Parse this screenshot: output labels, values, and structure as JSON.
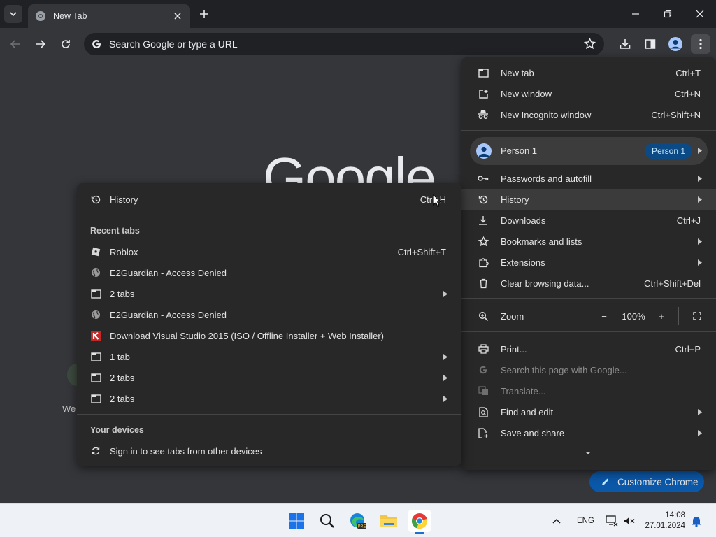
{
  "browser": {
    "tab_title": "New Tab",
    "omnibox_placeholder": "Search Google or type a URL"
  },
  "page": {
    "logo_text": "Google",
    "welcome_partial": "We",
    "customize_label": "Customize Chrome"
  },
  "main_menu": {
    "items": [
      {
        "label": "New tab",
        "shortcut": "Ctrl+T"
      },
      {
        "label": "New window",
        "shortcut": "Ctrl+N"
      },
      {
        "label": "New Incognito window",
        "shortcut": "Ctrl+Shift+N"
      }
    ],
    "profile": {
      "name": "Person 1",
      "badge": "Person 1"
    },
    "items2": [
      {
        "label": "Passwords and autofill"
      },
      {
        "label": "History"
      },
      {
        "label": "Downloads",
        "shortcut": "Ctrl+J"
      },
      {
        "label": "Bookmarks and lists"
      },
      {
        "label": "Extensions"
      },
      {
        "label": "Clear browsing data...",
        "shortcut": "Ctrl+Shift+Del"
      }
    ],
    "zoom": {
      "label": "Zoom",
      "minus": "−",
      "value": "100%",
      "plus": "+"
    },
    "items3": [
      {
        "label": "Print...",
        "shortcut": "Ctrl+P"
      },
      {
        "label": "Search this page with Google..."
      },
      {
        "label": "Translate..."
      },
      {
        "label": "Find and edit"
      },
      {
        "label": "Save and share"
      }
    ]
  },
  "history_menu": {
    "header": {
      "label": "History",
      "shortcut": "Ctrl+H"
    },
    "recent_tabs_heading": "Recent tabs",
    "recent": [
      {
        "label": "Roblox",
        "shortcut": "Ctrl+Shift+T",
        "icon": "roblox-icon"
      },
      {
        "label": "E2Guardian - Access Denied",
        "icon": "globe-icon"
      },
      {
        "label": "2 tabs",
        "icon": "window-icon"
      },
      {
        "label": "E2Guardian - Access Denied",
        "icon": "globe-icon"
      },
      {
        "label": "Download Visual Studio 2015 (ISO / Offline Installer + Web Installer)",
        "icon": "k-site-icon"
      },
      {
        "label": "1 tab",
        "icon": "window-icon"
      },
      {
        "label": "2 tabs",
        "icon": "window-icon"
      },
      {
        "label": "2 tabs",
        "icon": "window-icon"
      }
    ],
    "devices_heading": "Your devices",
    "devices_item": "Sign in to see tabs from other devices"
  },
  "taskbar": {
    "language": "ENG",
    "time": "14:08",
    "date": "27.01.2024"
  },
  "colors": {
    "accent": "#0b57a8",
    "menu_bg": "#282828",
    "page_bg": "#35363a",
    "tabstrip_bg": "#202124"
  }
}
